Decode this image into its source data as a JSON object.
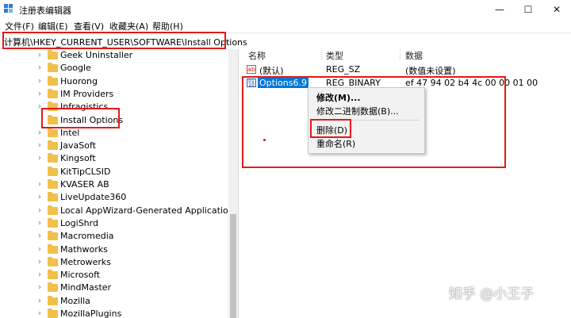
{
  "window": {
    "title": "注册表编辑器",
    "minimize": "—",
    "maximize": "☐",
    "close": "✕"
  },
  "menu": [
    "文件(F)",
    "编辑(E)",
    "查看(V)",
    "收藏夹(A)",
    "帮助(H)"
  ],
  "address": "计算机\\HKEY_CURRENT_USER\\SOFTWARE\\Install Options",
  "tree": {
    "items": [
      "Geek Uninstaller",
      "Google",
      "Huorong",
      "IM Providers",
      "Infragistics",
      "Install Options",
      "Intel",
      "JavaSoft",
      "Kingsoft",
      "KitTipCLSID",
      "KVASER AB",
      "LiveUpdate360",
      "Local AppWizard-Generated Applications",
      "LogiShrd",
      "Macromedia",
      "Mathworks",
      "Metrowerks",
      "Microsoft",
      "MindMaster",
      "Mozilla",
      "MozillaPlugins"
    ],
    "chevrons": [
      true,
      true,
      true,
      true,
      true,
      false,
      true,
      true,
      true,
      false,
      true,
      true,
      true,
      true,
      true,
      true,
      true,
      true,
      true,
      true,
      true
    ],
    "selected": "Install Options"
  },
  "columns": {
    "name": "名称",
    "type": "类型",
    "data": "数据"
  },
  "values": [
    {
      "name": "(默认)",
      "type": "REG_SZ",
      "data": "(数值未设置)"
    },
    {
      "name": "Options6.9",
      "type": "REG_BINARY",
      "data": "ef 47 94 02 b4 4c 00 00 01 00"
    }
  ],
  "context_menu": {
    "modify": "修改(M)...",
    "modify_binary": "修改二进制数据(B)...",
    "delete": "删除(D)",
    "rename": "重命名(R)"
  },
  "watermark": "知乎 @小王子",
  "colors": {
    "highlight": "#0078d7",
    "annotation": "#e01a1a",
    "folder": "#f1c04b"
  }
}
